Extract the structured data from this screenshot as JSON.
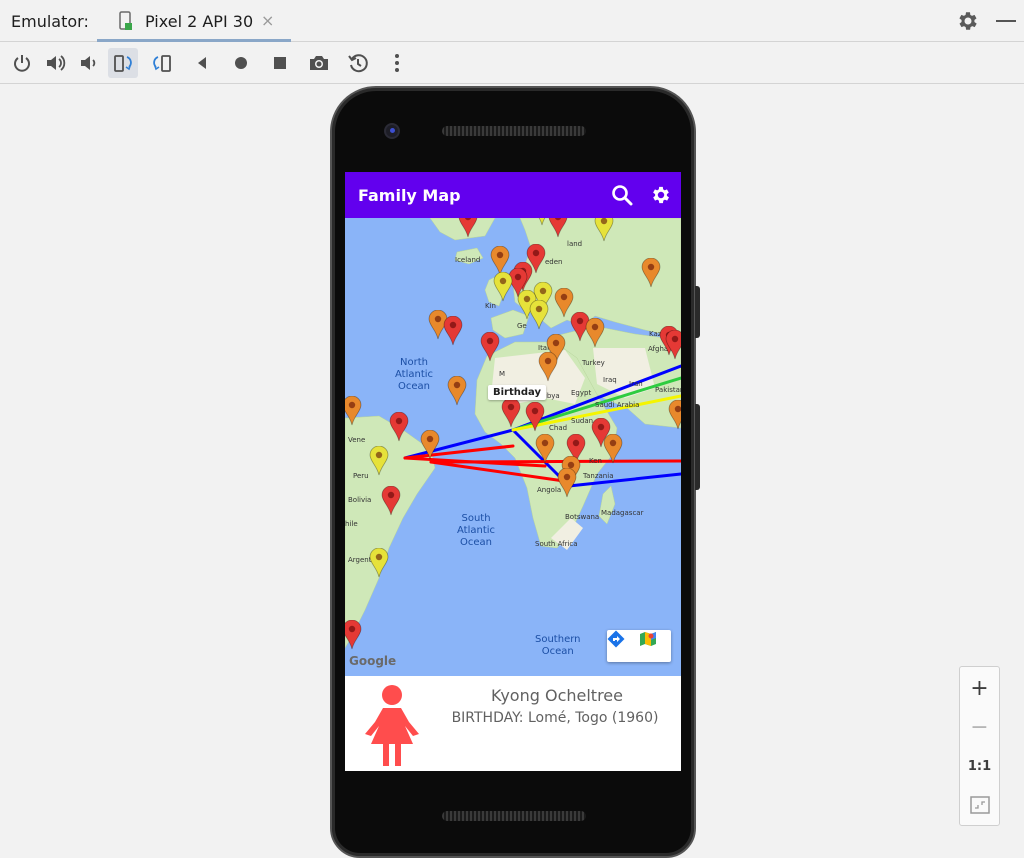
{
  "emulator": {
    "label": "Emulator:",
    "tab_label": "Pixel 2 API 30",
    "tab_close": "×",
    "toolbar_icons": [
      "power-icon",
      "volume-up-icon",
      "volume-down-icon",
      "rotate-left-icon",
      "rotate-right-icon",
      "back-icon",
      "home-icon",
      "overview-icon",
      "screenshot-icon",
      "snapshot-icon",
      "more-icon"
    ]
  },
  "app": {
    "title": "Family Map",
    "accent_color": "#6200ee"
  },
  "map": {
    "info_window": "Birthday",
    "google": "Google",
    "oceans": {
      "north_atlantic_1": "North",
      "north_atlantic_2": "Atlantic",
      "north_atlantic_3": "Ocean",
      "south_atlantic_1": "South",
      "south_atlantic_2": "Atlantic",
      "south_atlantic_3": "Ocean",
      "southern_1": "Southern",
      "southern_2": "Ocean"
    },
    "places": {
      "iceland": "Iceland",
      "sweden": "eden",
      "finland": "land",
      "kazakhstan": "Kazakhst",
      "afghanistan": "Afghanis",
      "pakistan": "Pakistan",
      "turkey": "Turkey",
      "iraq": "Iraq",
      "iran": "Iran",
      "egypt": "Egypt",
      "libya": "Libya",
      "saudi": "Saudi Arabia",
      "sudan": "Sudan",
      "chad": "Chad",
      "kenya": "Ken",
      "tanzania": "Tanzania",
      "angola": "Angola",
      "botswana": "Botswana",
      "madagascar": "Madagascar",
      "south_africa": "South Africa",
      "bolivia": "Bolivia",
      "argentina": "Argentina",
      "uk": "Kin",
      "venezuela": "Vene",
      "peru": "Peru",
      "chile": "hile",
      "italy": "Italy",
      "germany": "Ge",
      "morocco": "M"
    },
    "marker_colors": {
      "red": "#e53935",
      "orange": "#e8892c",
      "yellow": "#e6e23a"
    },
    "line_colors": {
      "red": "#ff0000",
      "blue": "#0000ff",
      "green": "#2ecc40",
      "yellow": "#f5f500"
    }
  },
  "person": {
    "name": "Kyong Ocheltree",
    "event": "BIRTHDAY: Lomé, Togo (1960)",
    "gender_color": "#ff4d4d"
  },
  "zoom": {
    "plus": "+",
    "minus": "−",
    "one_to_one": "1:1"
  }
}
